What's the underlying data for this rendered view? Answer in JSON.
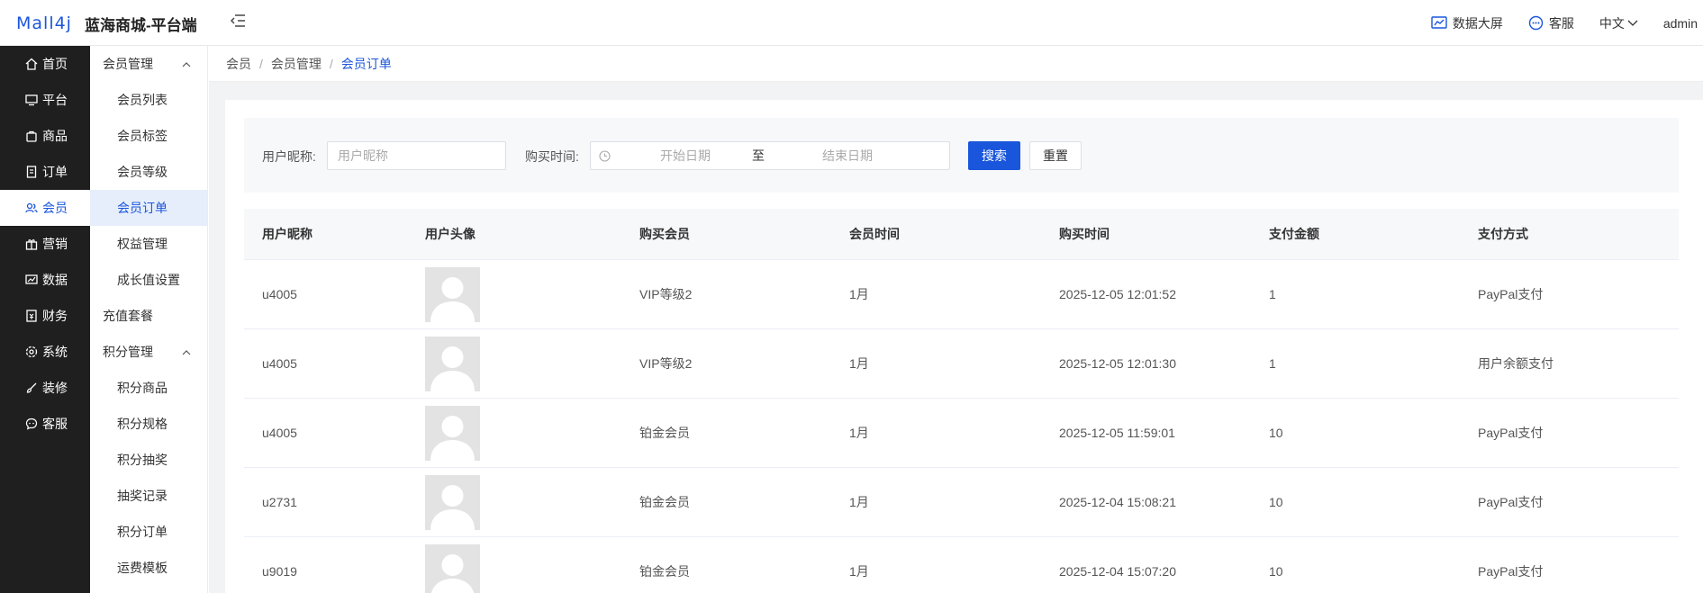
{
  "header": {
    "logo": "Mall4j",
    "brand": "蓝海商城-平台端",
    "items": {
      "dashboard": "数据大屏",
      "service": "客服",
      "language": "中文",
      "user": "admin"
    }
  },
  "nav": {
    "items": [
      {
        "label": "首页",
        "icon": "home-icon"
      },
      {
        "label": "平台",
        "icon": "monitor-icon"
      },
      {
        "label": "商品",
        "icon": "bag-icon"
      },
      {
        "label": "订单",
        "icon": "document-icon"
      },
      {
        "label": "会员",
        "icon": "users-icon"
      },
      {
        "label": "营销",
        "icon": "gift-icon"
      },
      {
        "label": "数据",
        "icon": "chart-icon"
      },
      {
        "label": "财务",
        "icon": "wallet-icon"
      },
      {
        "label": "系统",
        "icon": "gear-icon"
      },
      {
        "label": "装修",
        "icon": "brush-icon"
      },
      {
        "label": "客服",
        "icon": "chat-icon"
      }
    ]
  },
  "submenu": {
    "group1": "会员管理",
    "items1": [
      "会员列表",
      "会员标签",
      "会员等级",
      "会员订单",
      "权益管理",
      "成长值设置"
    ],
    "single": "充值套餐",
    "group2": "积分管理",
    "items2": [
      "积分商品",
      "积分规格",
      "积分抽奖",
      "抽奖记录",
      "积分订单",
      "运费模板"
    ]
  },
  "breadcrumb": [
    "会员",
    "会员管理",
    "会员订单"
  ],
  "search": {
    "nickname_label": "用户昵称:",
    "nickname_placeholder": "用户昵称",
    "time_label": "购买时间:",
    "start_placeholder": "开始日期",
    "range_sep": "至",
    "end_placeholder": "结束日期",
    "search_btn": "搜索",
    "reset_btn": "重置"
  },
  "table": {
    "headers": [
      "用户昵称",
      "用户头像",
      "购买会员",
      "会员时间",
      "购买时间",
      "支付金额",
      "支付方式"
    ],
    "rows": [
      {
        "nickname": "u4005",
        "level": "VIP等级2",
        "duration": "1月",
        "time": "2025-12-05 12:01:52",
        "amount": "1",
        "method": "PayPal支付"
      },
      {
        "nickname": "u4005",
        "level": "VIP等级2",
        "duration": "1月",
        "time": "2025-12-05 12:01:30",
        "amount": "1",
        "method": "用户余额支付"
      },
      {
        "nickname": "u4005",
        "level": "铂金会员",
        "duration": "1月",
        "time": "2025-12-05 11:59:01",
        "amount": "10",
        "method": "PayPal支付"
      },
      {
        "nickname": "u2731",
        "level": "铂金会员",
        "duration": "1月",
        "time": "2025-12-04 15:08:21",
        "amount": "10",
        "method": "PayPal支付"
      },
      {
        "nickname": "u9019",
        "level": "铂金会员",
        "duration": "1月",
        "time": "2025-12-04 15:07:20",
        "amount": "10",
        "method": "PayPal支付"
      }
    ]
  },
  "colors": {
    "accent": "#1a56db",
    "nav_bg": "#1f1f1f"
  }
}
